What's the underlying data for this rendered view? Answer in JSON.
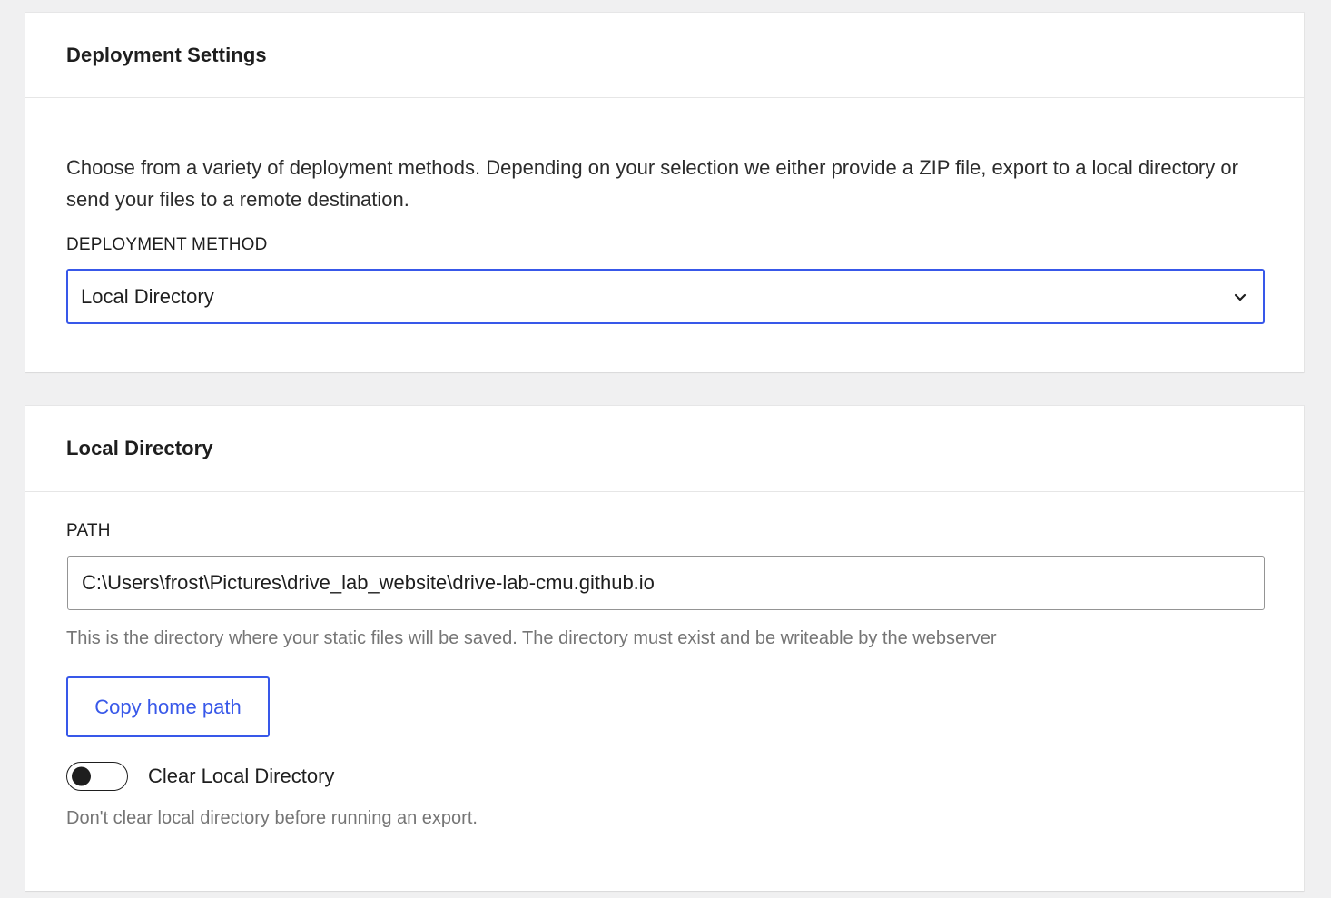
{
  "deployment_settings": {
    "title": "Deployment Settings",
    "description": "Choose from a variety of deployment methods. Depending on your selection we either provide a ZIP file, export to a local directory or send your files to a remote destination.",
    "method_label": "DEPLOYMENT METHOD",
    "method_value": "Local Directory",
    "chevron_icon": "chevron-down-icon"
  },
  "local_directory": {
    "title": "Local Directory",
    "path_label": "PATH",
    "path_value": "C:\\Users\\frost\\Pictures\\drive_lab_website\\drive-lab-cmu.github.io",
    "path_help": "This is the directory where your static files will be saved. The directory must exist and be writeable by the webserver",
    "copy_button_label": "Copy home path",
    "toggle_label": "Clear Local Directory",
    "toggle_checked": false,
    "toggle_help": "Don't clear local directory before running an export."
  },
  "colors": {
    "accent": "#3858e9",
    "background": "#f0f0f1",
    "muted_text": "#757575"
  }
}
